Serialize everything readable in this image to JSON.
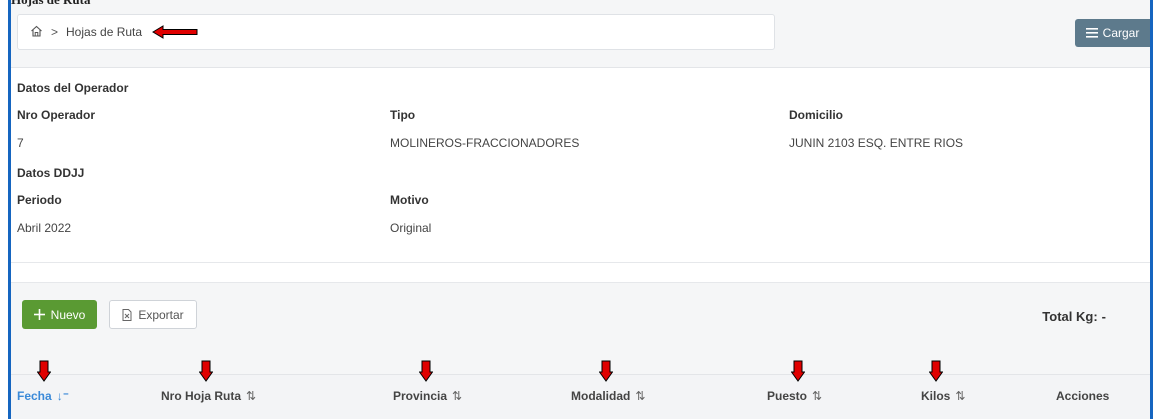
{
  "breadcrumb": {
    "home_icon": "home-icon",
    "separator": ">",
    "current": "Hojas de Ruta"
  },
  "header_clip": {
    "text": "Hojas de Ruta"
  },
  "cargar_button": {
    "icon": "menu-icon",
    "label": "Cargar"
  },
  "operador": {
    "section_title": "Datos del Operador",
    "nro_label": "Nro Operador",
    "nro_value": "7",
    "tipo_label": "Tipo",
    "tipo_value": "MOLINEROS-FRACCIONADORES",
    "domicilio_label": "Domicilio",
    "domicilio_value": "JUNIN 2103 ESQ. ENTRE RIOS"
  },
  "ddjj": {
    "section_title": "Datos DDJJ",
    "periodo_label": "Periodo",
    "periodo_value": "Abril 2022",
    "motivo_label": "Motivo",
    "motivo_value": "Original"
  },
  "toolbar": {
    "nuevo_label": "Nuevo",
    "nuevo_icon": "plus-icon",
    "exportar_label": "Exportar",
    "exportar_icon": "file-icon",
    "total_label": "Total Kg:",
    "total_value": "-"
  },
  "table": {
    "columns": [
      {
        "label": "Fecha",
        "sort": "↓⁼",
        "active": true
      },
      {
        "label": "Nro Hoja Ruta",
        "sort": "⇅"
      },
      {
        "label": "Provincia",
        "sort": "⇅"
      },
      {
        "label": "Modalidad",
        "sort": "⇅"
      },
      {
        "label": "Puesto",
        "sort": "⇅"
      },
      {
        "label": "Kilos",
        "sort": "⇅"
      },
      {
        "label": "Acciones",
        "sort": ""
      }
    ]
  },
  "colors": {
    "accent": "#3b8ad8",
    "success": "#5a9a33",
    "cargar": "#5d7a8c",
    "annotation_arrow": "#e00000",
    "frame": "#1565c0"
  }
}
